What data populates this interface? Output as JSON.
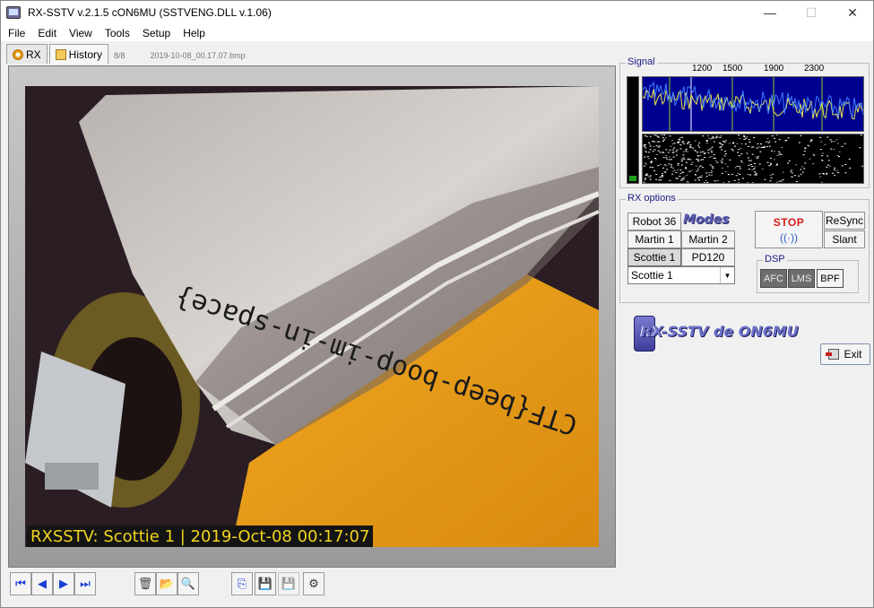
{
  "window": {
    "title": "RX-SSTV v.2.1.5 cON6MU (SSTVENG.DLL v.1.06)",
    "controls": {
      "minimize": "—",
      "maximize": "☐",
      "close": "✕"
    }
  },
  "menu": [
    "File",
    "Edit",
    "View",
    "Tools",
    "Setup",
    "Help"
  ],
  "tabs": {
    "rx_label": "RX",
    "history_label": "History",
    "count": "8/8",
    "filename": "2019-10-08_00.17.07.bmp"
  },
  "image": {
    "caption": "RXSSTV: Scottie 1 | 2019-Oct-08 00:17:07",
    "handwriting": "CTF{beep-boop-im-in-space}"
  },
  "toolbar": {
    "first": "⏮",
    "prev": "◀",
    "next": "▶",
    "last": "⏭",
    "delete": "🗑",
    "open": "📂",
    "zoom": "🔍",
    "copy": "⎘",
    "save": "💾",
    "save_as": "💾",
    "settings": "⚙"
  },
  "signal": {
    "label": "Signal",
    "scale": [
      "1200",
      "1500",
      "1900",
      "2300"
    ],
    "level": 0.05,
    "colors": {
      "spectrum_bg": "#000090",
      "spectrum_line": "#3c7bff",
      "peak_line": "#e8e84a",
      "marker": "#8cd02a"
    }
  },
  "rx_options": {
    "label": "RX options",
    "modes_logo": "Modes",
    "buttons": [
      "Robot 36",
      "Martin 1",
      "Martin 2",
      "Scottie 1",
      "PD120"
    ],
    "selected": "Scottie 1",
    "dropdown_value": "Scottie 1",
    "stop": "STOP",
    "resync": "ReSync",
    "slant": "Slant",
    "dsp": {
      "label": "DSP",
      "afc": "AFC",
      "lms": "LMS",
      "bpf": "BPF",
      "afc_on": true,
      "lms_on": true,
      "bpf_on": false
    }
  },
  "branding": {
    "logo_text": "RX-SSTV de ON6MU"
  },
  "exit_label": "Exit"
}
